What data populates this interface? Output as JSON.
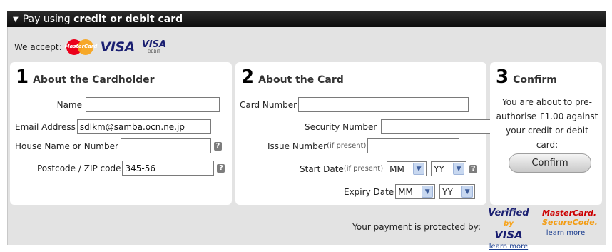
{
  "header": {
    "prefix": "Pay using ",
    "bold": "credit or debit card"
  },
  "accept": {
    "label": "We accept:",
    "mastercard": "MasterCard",
    "visa": "VISA",
    "visa_debit_top": "VISA",
    "visa_debit_bottom": "DEBIT"
  },
  "cardholder": {
    "num": "1",
    "title": "About the Cardholder",
    "name_label": "Name",
    "name_value": "",
    "email_label": "Email Address",
    "email_value": "sdlkm@samba.ocn.ne.jp",
    "house_label": "House Name or Number",
    "house_value": "",
    "postcode_label": "Postcode / ZIP code",
    "postcode_value": "345-56"
  },
  "card": {
    "num": "2",
    "title": "About the Card",
    "number_label": "Card Number",
    "number_value": "",
    "security_label": "Security Number",
    "security_value": "",
    "issue_label": "Issue Number",
    "issue_hint": "(if present)",
    "issue_value": "",
    "start_label": "Start Date",
    "start_hint": "(if present)",
    "start_month": "MM",
    "start_year": "YY",
    "expiry_label": "Expiry Date",
    "expiry_month": "MM",
    "expiry_year": "YY"
  },
  "confirm": {
    "num": "3",
    "title": "Confirm",
    "text": "You are about to pre-authorise £1.00 against your credit or debit card:",
    "button": "Confirm"
  },
  "footer": {
    "protected": "Your payment is protected by:",
    "vbv_line1": "Verified",
    "vbv_by": "by",
    "vbv_line2": "VISA",
    "vbv_link": "learn more",
    "msc_line1": "MasterCard.",
    "msc_line2": "SecureCode.",
    "msc_link": "learn more"
  },
  "help_glyph": "?",
  "dropdown_glyph": "▼"
}
